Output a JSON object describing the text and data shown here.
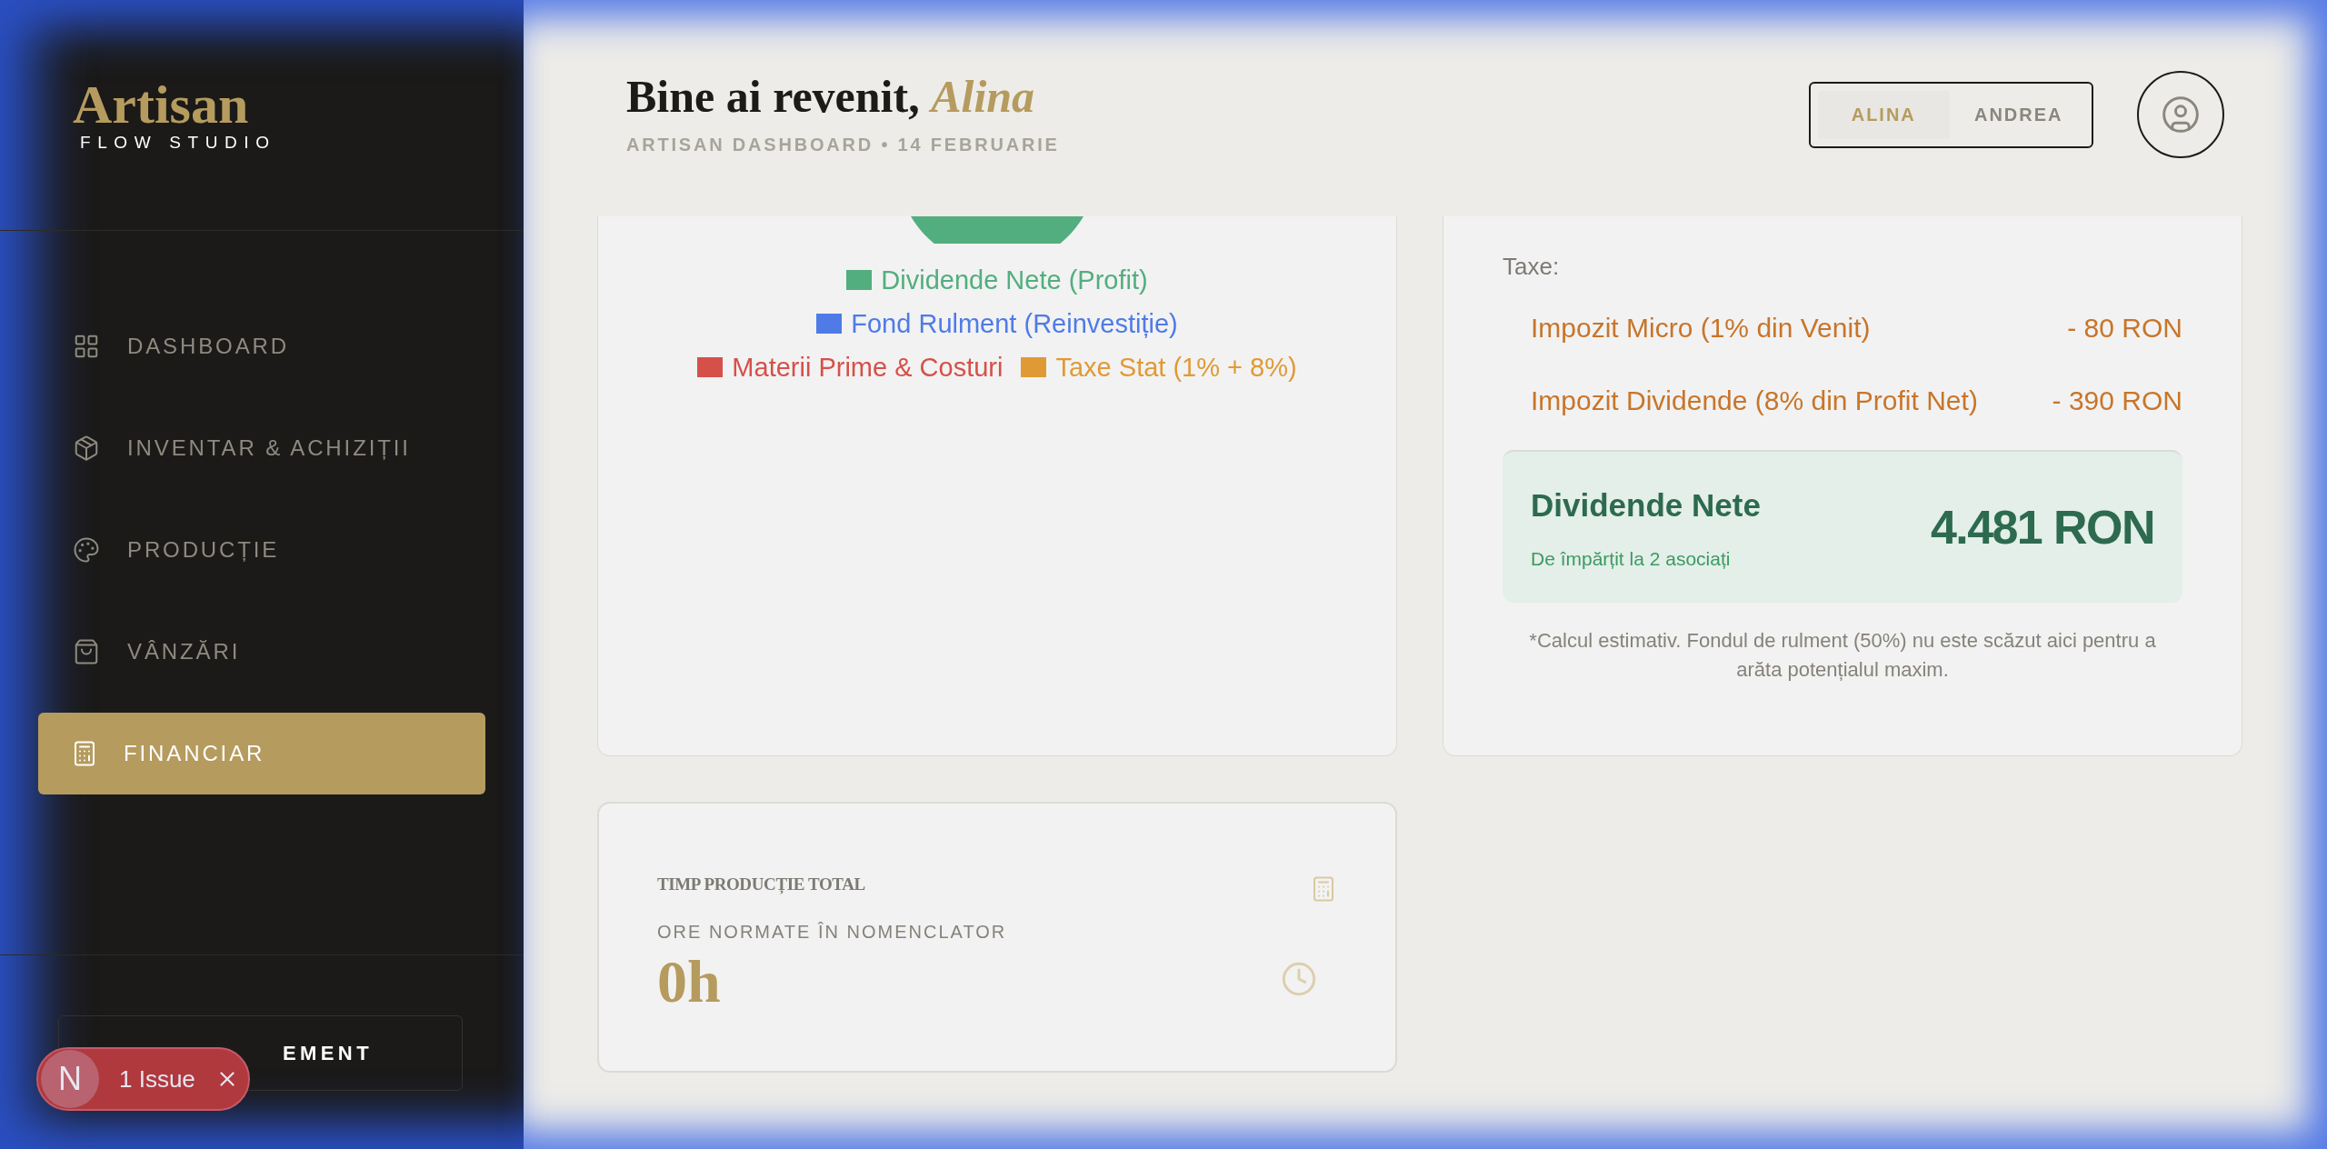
{
  "sidebar": {
    "logo": {
      "title": "Artisan",
      "subtitle": "FLOW STUDIO"
    },
    "nav": [
      {
        "label": "DASHBOARD",
        "selected": false
      },
      {
        "label": "INVENTAR & ACHIZIȚII",
        "selected": false
      },
      {
        "label": "PRODUCȚIE",
        "selected": false
      },
      {
        "label": "VÂNZĂRI",
        "selected": false
      },
      {
        "label": "FINANCIAR",
        "selected": true
      }
    ],
    "bottom_button": {
      "label": "EMENT"
    }
  },
  "header": {
    "greeting": "Bine ai revenit,",
    "name": "Alina",
    "subtitle": "ARTISAN DASHBOARD • 14 FEBRUARIE",
    "user_toggle": [
      {
        "label": "ALINA",
        "selected": true
      },
      {
        "label": "ANDREA",
        "selected": false
      }
    ]
  },
  "distribution_card": {
    "legend": [
      {
        "label": "Dividende Nete (Profit)",
        "color": "#52ae7e"
      },
      {
        "label": "Fond Rulment (Reinvestiție)",
        "color": "#4f7be6"
      },
      {
        "label": "Materii Prime & Costuri",
        "color": "#d6504a"
      },
      {
        "label": "Taxe Stat (1% + 8%)",
        "color": "#e09a35"
      }
    ]
  },
  "dividends_card": {
    "taxes_label": "Taxe:",
    "taxes": [
      {
        "label": "Impozit Micro (1% din Venit)",
        "amount": "- 80 RON"
      },
      {
        "label": "Impozit Dividende (8% din Profit Net)",
        "amount": "- 390 RON"
      }
    ],
    "net": {
      "title": "Dividende Nete",
      "subtitle": "De împărțit la 2 asociați",
      "amount": "4.481 RON"
    },
    "note": "*Calcul estimativ. Fondul de rulment (50%) nu este scăzut aici pentru a arăta potențialul maxim."
  },
  "production_card": {
    "title": "TIMP PRODUCȚIE TOTAL",
    "subtitle": "ORE NORMATE ÎN NOMENCLATOR",
    "value": "0h"
  },
  "issue_toast": {
    "badge": "N",
    "label": "1 Issue"
  }
}
